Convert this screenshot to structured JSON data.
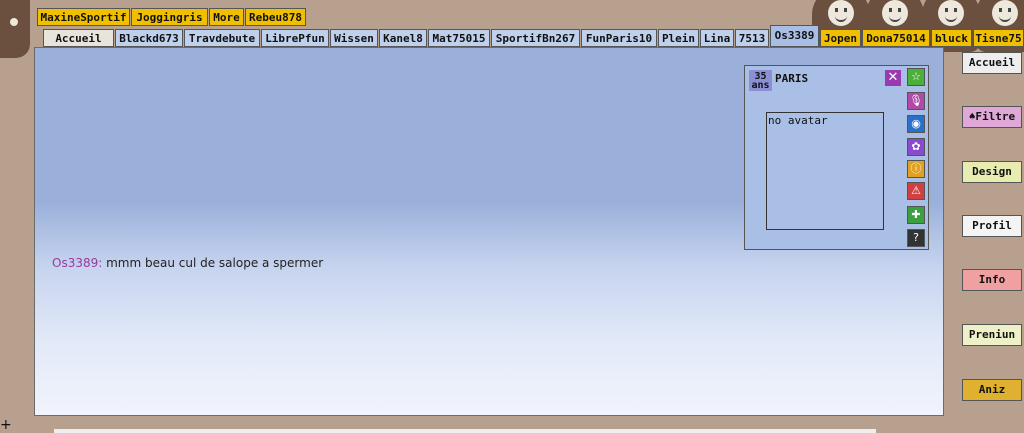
{
  "top_tabs": [
    "MaxineSportif",
    "Joggingris",
    "More",
    "Rebeu878"
  ],
  "tabs": [
    {
      "label": "Accueil",
      "style": "home"
    },
    {
      "label": "Blackd673",
      "style": "normal"
    },
    {
      "label": "Travdebute",
      "style": "normal"
    },
    {
      "label": "LibrePfun",
      "style": "normal"
    },
    {
      "label": "Wissen",
      "style": "normal"
    },
    {
      "label": "Kanel8",
      "style": "normal"
    },
    {
      "label": "Mat75015",
      "style": "normal"
    },
    {
      "label": "SportifBn267",
      "style": "normal"
    },
    {
      "label": "FunParis10",
      "style": "normal"
    },
    {
      "label": "Plein",
      "style": "normal"
    },
    {
      "label": "Lina",
      "style": "normal"
    },
    {
      "label": "7513",
      "style": "normal"
    },
    {
      "label": "Os3389",
      "style": "active"
    },
    {
      "label": "Jopen",
      "style": "yellow"
    },
    {
      "label": "Dona75014",
      "style": "yellow"
    },
    {
      "label": "bluck",
      "style": "yellow"
    },
    {
      "label": "Tisne75",
      "style": "yellow"
    }
  ],
  "chat": {
    "nick": "Os3389:",
    "text": " mmm beau cul de salope a spermer"
  },
  "profile": {
    "age_number": "35",
    "age_unit": "ans",
    "city": "PARIS",
    "close": "✕",
    "avatar_text": "no avatar",
    "icons": [
      {
        "name": "star-icon",
        "glyph": "☆",
        "color": "#4caf3a"
      },
      {
        "name": "microphone-icon",
        "glyph": "🎙",
        "color": "#b04aa8"
      },
      {
        "name": "webcam-icon",
        "glyph": "◉",
        "color": "#2a6fc9"
      },
      {
        "name": "flower-icon",
        "glyph": "✿",
        "color": "#8a4ad0"
      },
      {
        "name": "info-icon",
        "glyph": "ⓘ",
        "color": "#e0a020"
      },
      {
        "name": "warning-icon",
        "glyph": "⚠",
        "color": "#d04040"
      },
      {
        "name": "plus-icon",
        "glyph": "✚",
        "color": "#3aa040"
      },
      {
        "name": "help-icon",
        "glyph": "?",
        "color": "#333333"
      }
    ]
  },
  "side_buttons": [
    {
      "label": "Accueil",
      "color": "#eeeeee"
    },
    {
      "label": "♠Filtre",
      "color": "#e0a8d8"
    },
    {
      "label": "Design",
      "color": "#e8ecb0"
    },
    {
      "label": "Profil",
      "color": "#f4f4f4"
    },
    {
      "label": "Info",
      "color": "#f0a0a0"
    },
    {
      "label": "Preniun",
      "color": "#eef0c8"
    },
    {
      "label": "Aniz",
      "color": "#e0b030"
    }
  ],
  "bottom_plus": "+"
}
